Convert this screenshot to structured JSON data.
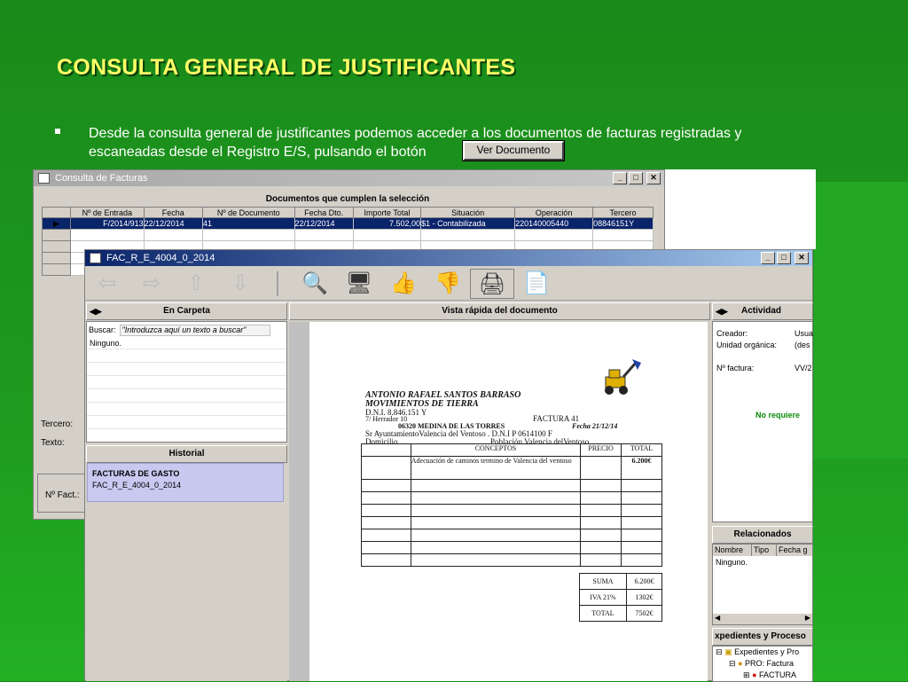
{
  "slide": {
    "title": "CONSULTA GENERAL DE JUSTIFICANTES",
    "bullet_line1": "Desde la consulta general de justificantes podemos acceder a los documentos de facturas registradas y",
    "bullet_line2": "escaneadas desde el Registro E/S, pulsando el botón",
    "button_label": "Ver Documento"
  },
  "back_window": {
    "title": "Consulta de Facturas",
    "caption": "Documentos que cumplen la selección",
    "columns": [
      "Nº de Entrada",
      "Fecha",
      "Nº de Documento",
      "Fecha Dto.",
      "Importe Total",
      "Situación",
      "Operación",
      "Tercero"
    ],
    "row": [
      "F/2014/913",
      "22/12/2014",
      "41",
      "22/12/2014",
      "7.502,00",
      "$1 - Contabilizada",
      "220140005440",
      "08846151Y"
    ],
    "labels": {
      "tercero": "Tercero:",
      "texto": "Texto:",
      "nfact": "Nº Fact.:"
    }
  },
  "front_window": {
    "title": "FAC_R_E_4004_0_2014",
    "panels": {
      "en_carpeta": "En Carpeta",
      "vista_rapida": "Vista rápida del documento",
      "actividad": "Actividad",
      "historial": "Historial",
      "relacionados": "Relacionados",
      "expedientes": "xpedientes y Proceso"
    },
    "search": {
      "label": "Buscar:",
      "placeholder": "\"Introduzca aquí un texto a buscar\""
    },
    "carpeta_item": "Ninguno.",
    "historial": {
      "heading": "FACTURAS DE GASTO",
      "item": "FAC_R_E_4004_0_2014"
    },
    "actividad": {
      "creador_label": "Creador:",
      "creador_value": "Usua",
      "unidad_label": "Unidad orgánica:",
      "unidad_value": "(des",
      "factura_label": "Nº factura:",
      "factura_value": "VV/2",
      "status": "No requiere"
    },
    "relacionados": {
      "columns": [
        "Nombre",
        "Tipo",
        "Fecha g"
      ],
      "item": "Ninguno."
    },
    "tree": [
      "Expedientes y Pro",
      "PRO: Factura",
      "FACTURA"
    ]
  },
  "invoice": {
    "name": "ANTONIO RAFAEL SANTOS BARRASO",
    "business": "MOVIMIENTOS DE  TIERRA",
    "dni": "D.N.I. 8.846.151 Y",
    "address": "7/ Herrador 10",
    "factura": "FACTURA 41",
    "cp": "06320 MEDINA DE LAS TORRES",
    "fecha": "Fecha 21/12/14",
    "client": "Sr AyuntamientoValencia del Ventoso .  D.N.I P 0614100 F",
    "domicilio": "Domicilio",
    "poblacion": "Población Valencia delVentoso",
    "headers": [
      "CONCEPTOS",
      "PRECIO",
      "TOTAL"
    ],
    "concept": "Adecuación de caminos termino de Valencia del ventoso",
    "concept_total": "6.200€",
    "suma_label": "SUMA",
    "suma": "6.200€",
    "iva_label": "IVA 21%",
    "iva": "1302€",
    "total_label": "TOTAL",
    "total": "7502€"
  }
}
